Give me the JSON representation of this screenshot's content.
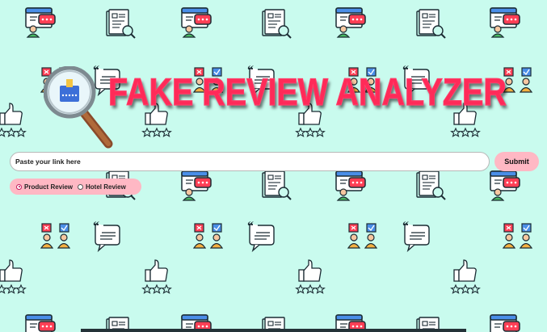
{
  "app": {
    "title": "FAKE REVIEW ANALYZER"
  },
  "search": {
    "placeholder": "Paste your link here",
    "value": "",
    "submit_label": "Submit"
  },
  "review_type": {
    "options": [
      {
        "label": "Product Review",
        "selected": true
      },
      {
        "label": "Hotel Review",
        "selected": false
      }
    ]
  },
  "colors": {
    "background": "#c9fbee",
    "title": "#ff2a58",
    "accent_pink": "#ffb8c4"
  },
  "icons": {
    "background_pattern": [
      "browser-chat-icon",
      "document-search-icon",
      "vote-people-icon",
      "quote-bubble-icon",
      "thumbs-up-stars-icon"
    ],
    "logo": "magnifier-review-icon"
  }
}
